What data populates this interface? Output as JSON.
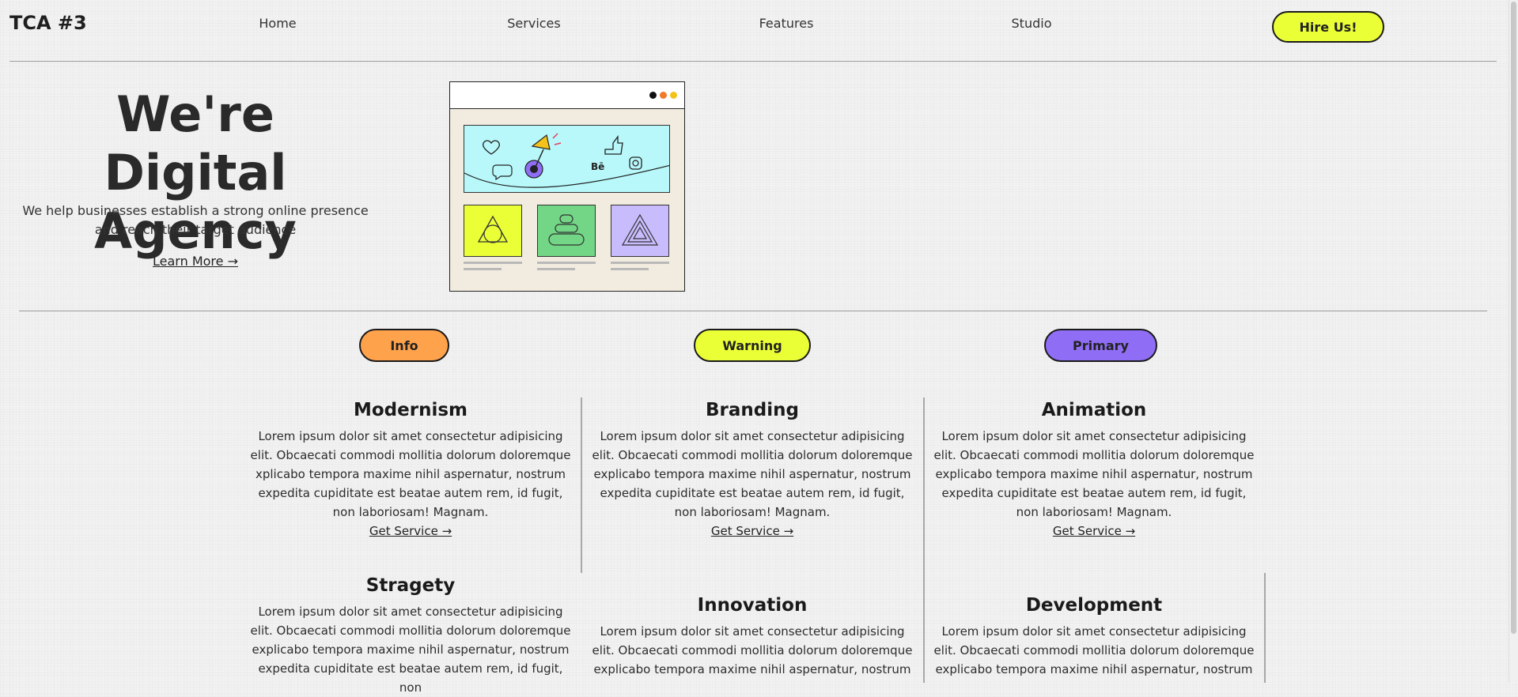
{
  "nav": {
    "brand": "TCA #3",
    "links": [
      "Home",
      "Services",
      "Features",
      "Studio"
    ],
    "cta": "Hire Us!"
  },
  "hero": {
    "title_line1": "We're Digital",
    "title_line2": "Agency",
    "subtitle": "We help businesses establish a strong online presence and reach their target audience",
    "link": "Learn More →"
  },
  "badges": [
    {
      "label": "Info",
      "color": "#ffa24c"
    },
    {
      "label": "Warning",
      "color": "#eaff36"
    },
    {
      "label": "Primary",
      "color": "#8f6ef5"
    }
  ],
  "services": [
    {
      "title": "Modernism",
      "text": "Lorem ipsum dolor sit amet consectetur adipisicing elit. Obcaecati commodi mollitia dolorum doloremque xplicabo tempora maxime nihil aspernatur, nostrum expedita cupiditate est beatae autem rem, id fugit, non laboriosam! Magnam.",
      "link": "Get Service →"
    },
    {
      "title": "Branding",
      "text": "Lorem ipsum dolor sit amet consectetur adipisicing elit. Obcaecati commodi mollitia dolorum doloremque explicabo tempora maxime nihil aspernatur, nostrum expedita cupiditate est beatae autem rem, id fugit, non laboriosam! Magnam.",
      "link": "Get Service →"
    },
    {
      "title": "Animation",
      "text": "Lorem ipsum dolor sit amet consectetur adipisicing elit. Obcaecati commodi mollitia dolorum doloremque explicabo tempora maxime nihil aspernatur, nostrum expedita cupiditate est beatae autem rem, id fugit, non laboriosam! Magnam.",
      "link": "Get Service →"
    },
    {
      "title": "Stragety",
      "text": "Lorem ipsum dolor sit amet consectetur adipisicing elit. Obcaecati commodi mollitia dolorum doloremque explicabo tempora maxime nihil aspernatur, nostrum expedita cupiditate est beatae autem rem, id fugit, non"
    },
    {
      "title": "Innovation",
      "text": "Lorem ipsum dolor sit amet consectetur adipisicing elit. Obcaecati commodi mollitia dolorum doloremque explicabo tempora maxime nihil aspernatur, nostrum"
    },
    {
      "title": "Development",
      "text": "Lorem ipsum dolor sit amet consectetur adipisicing elit. Obcaecati commodi mollitia dolorum doloremque explicabo tempora maxime nihil aspernatur, nostrum"
    }
  ],
  "illustration": {
    "banner_text": "Bē",
    "colors": {
      "banner": "#b8f8fa",
      "tile1": "#eaff36",
      "tile2": "#72d686",
      "tile3": "#c9bcfc"
    },
    "icons": [
      "heart-icon",
      "megaphone-icon",
      "thumbs-up-icon",
      "chat-icon",
      "behance-icon",
      "instagram-icon",
      "triangle-icon",
      "stack-icon",
      "nested-triangle-icon"
    ]
  }
}
